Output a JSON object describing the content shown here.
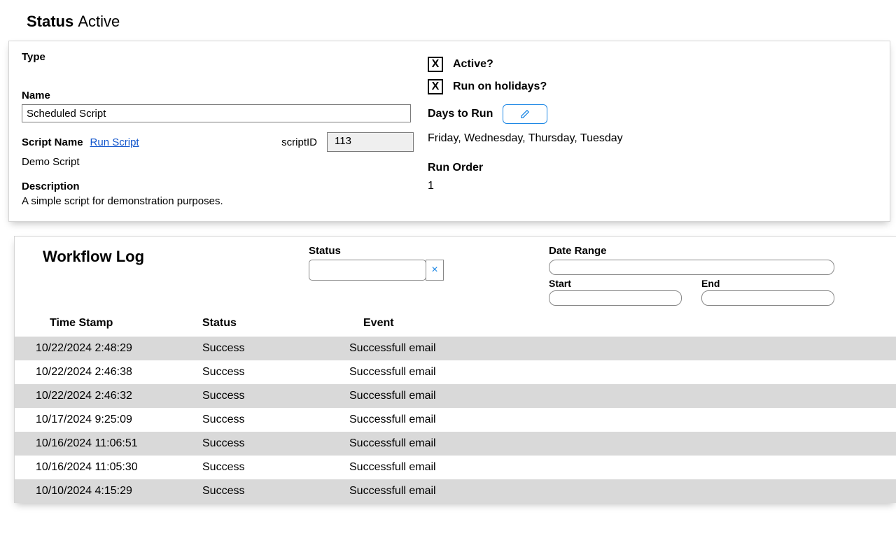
{
  "header": {
    "status_label": "Status",
    "status_value": "Active"
  },
  "details": {
    "type_label": "Type",
    "name_label": "Name",
    "name_value": "Scheduled Script",
    "script_name_label": "Script Name",
    "run_script_link": "Run Script",
    "scriptid_label": "scriptID",
    "scriptid_value": "113",
    "script_name_value": "Demo Script",
    "description_label": "Description",
    "description_value": "A simple script for demonstration purposes.",
    "active_label": "Active?",
    "active_checked": "X",
    "holidays_label": "Run on holidays?",
    "holidays_checked": "X",
    "days_label": "Days to Run",
    "days_value": "Friday, Wednesday, Thursday, Tuesday",
    "run_order_label": "Run Order",
    "run_order_value": "1"
  },
  "log": {
    "title": "Workflow Log",
    "status_label": "Status",
    "status_value": "",
    "clear_glyph": "×",
    "date_range_label": "Date Range",
    "date_range_value": "",
    "start_label": "Start",
    "start_value": "",
    "end_label": "End",
    "end_value": "",
    "columns": {
      "timestamp": "Time Stamp",
      "status": "Status",
      "event": "Event"
    },
    "rows": [
      {
        "timestamp": "10/22/2024 2:48:29",
        "status": "Success",
        "event": "Successfull email"
      },
      {
        "timestamp": "10/22/2024 2:46:38",
        "status": "Success",
        "event": "Successfull email"
      },
      {
        "timestamp": "10/22/2024 2:46:32",
        "status": "Success",
        "event": "Successfull email"
      },
      {
        "timestamp": "10/17/2024 9:25:09",
        "status": "Success",
        "event": "Successfull email"
      },
      {
        "timestamp": "10/16/2024 11:06:51",
        "status": "Success",
        "event": "Successfull email"
      },
      {
        "timestamp": "10/16/2024 11:05:30",
        "status": "Success",
        "event": "Successfull email"
      },
      {
        "timestamp": "10/10/2024 4:15:29",
        "status": "Success",
        "event": "Successfull email"
      }
    ]
  }
}
